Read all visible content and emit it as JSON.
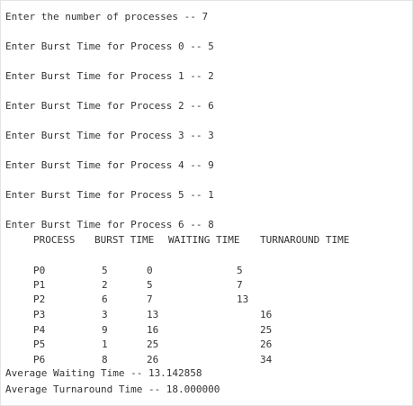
{
  "prompt_lines": [
    "Enter the number of processes -- 7",
    "Enter Burst Time for Process 0 -- 5",
    "Enter Burst Time for Process 1 -- 2",
    "Enter Burst Time for Process 2 -- 6",
    "Enter Burst Time for Process 3 -- 3",
    "Enter Burst Time for Process 4 -- 9",
    "Enter Burst Time for Process 5 -- 1",
    "Enter Burst Time for Process 6 -- 8"
  ],
  "table": {
    "headers": [
      "PROCESS",
      "BURST TIME",
      "WAITING TIME",
      "TURNAROUND TIME"
    ],
    "rows": [
      {
        "process": "P0",
        "burst": "5",
        "waiting": "0",
        "turnaround": "5"
      },
      {
        "process": "P1",
        "burst": "2",
        "waiting": "5",
        "turnaround": "7"
      },
      {
        "process": "P2",
        "burst": "6",
        "waiting": "7",
        "turnaround": "13"
      },
      {
        "process": "P3",
        "burst": "3",
        "waiting": "13",
        "turnaround": "16"
      },
      {
        "process": "P4",
        "burst": "9",
        "waiting": "16",
        "turnaround": "25"
      },
      {
        "process": "P5",
        "burst": "1",
        "waiting": "25",
        "turnaround": "26"
      },
      {
        "process": "P6",
        "burst": "8",
        "waiting": "26",
        "turnaround": "34"
      }
    ]
  },
  "summary": {
    "avg_waiting": "Average Waiting Time -- 13.142858",
    "avg_turnaround": "Average Turnaround Time -- 18.000000"
  }
}
